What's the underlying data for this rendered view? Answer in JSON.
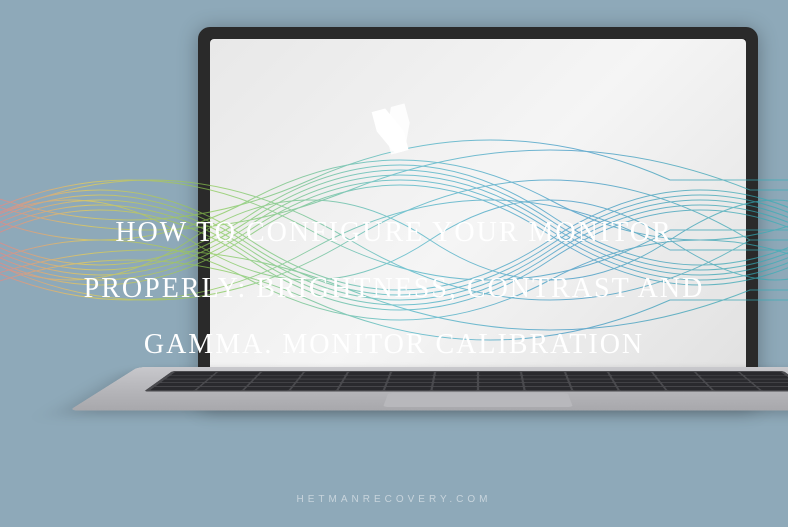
{
  "title": "How to configure your monitor properly: brightness, contrast and gamma. Monitor calibration",
  "footer": "hetmanrecovery.com",
  "logo_name": "hetman-logo",
  "colors": {
    "background": "#8ea9b9",
    "text": "#ffffff",
    "footer_text": "#c8d4dc"
  }
}
